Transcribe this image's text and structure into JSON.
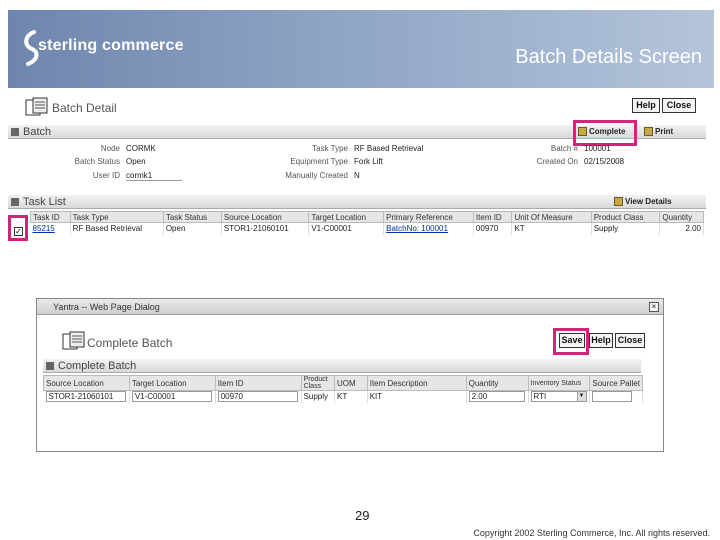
{
  "slide": {
    "logo_text": "sterling commerce",
    "title": "Batch Details Screen",
    "page_number": "29",
    "copyright": "Copyright 2002 Sterling Commerce, Inc. All rights reserved."
  },
  "batch_detail": {
    "title": "Batch Detail",
    "help_label": "Help",
    "close_label": "Close",
    "batch_section_label": "Batch",
    "complete_label": "Complete",
    "print_label": "Print",
    "fields": {
      "node_label": "Node",
      "node_value": "CORMK",
      "batch_status_label": "Batch Status",
      "batch_status_value": "Open",
      "user_id_label": "User ID",
      "user_id_value": "cormk1",
      "task_type_label": "Task Type",
      "task_type_value": "RF Based Retrieval",
      "equipment_type_label": "Equipment Type",
      "equipment_type_value": "Fork Lift",
      "manually_created_label": "Manually Created",
      "manually_created_value": "N",
      "batch_no_label": "Batch #",
      "batch_no_value": "100001",
      "created_on_label": "Created On",
      "created_on_value": "02/15/2008"
    },
    "task_list": {
      "label": "Task List",
      "view_details_label": "View Details",
      "columns": [
        "Task ID",
        "Task Type",
        "Task Status",
        "Source Location",
        "Target Location",
        "Primary Reference",
        "Item ID",
        "Unit Of Measure",
        "Product Class",
        "Quantity"
      ],
      "rows": [
        {
          "task_id": "85215",
          "task_type": "RF Based Retrieval",
          "task_status": "Open",
          "source_location": "STOR1-21060101",
          "target_location": "V1-C00001",
          "primary_reference": "BatchNo: 100001",
          "item_id": "00970",
          "uom": "KT",
          "product_class": "Supply",
          "quantity": "2.00"
        }
      ]
    }
  },
  "complete_batch_dialog": {
    "window_title": "Yantra -- Web Page Dialog",
    "title": "Complete Batch",
    "save_label": "Save",
    "help_label": "Help",
    "close_label": "Close",
    "section_label": "Complete Batch",
    "columns": [
      "Source Location",
      "Target Location",
      "Item ID",
      "Product Class",
      "UOM",
      "Item Description",
      "Quantity",
      "Inventory Status",
      "Source Pallet"
    ],
    "row": {
      "source_location": "STOR1-21060101",
      "target_location": "V1-C00001",
      "item_id": "00970",
      "product_class": "Supply",
      "uom": "KT",
      "item_description": "KIT",
      "quantity": "2.00",
      "inventory_status": "RTI",
      "source_pallet": ""
    }
  },
  "colors": {
    "highlight": "#d4247a",
    "header_blue": "#6e86ad"
  }
}
